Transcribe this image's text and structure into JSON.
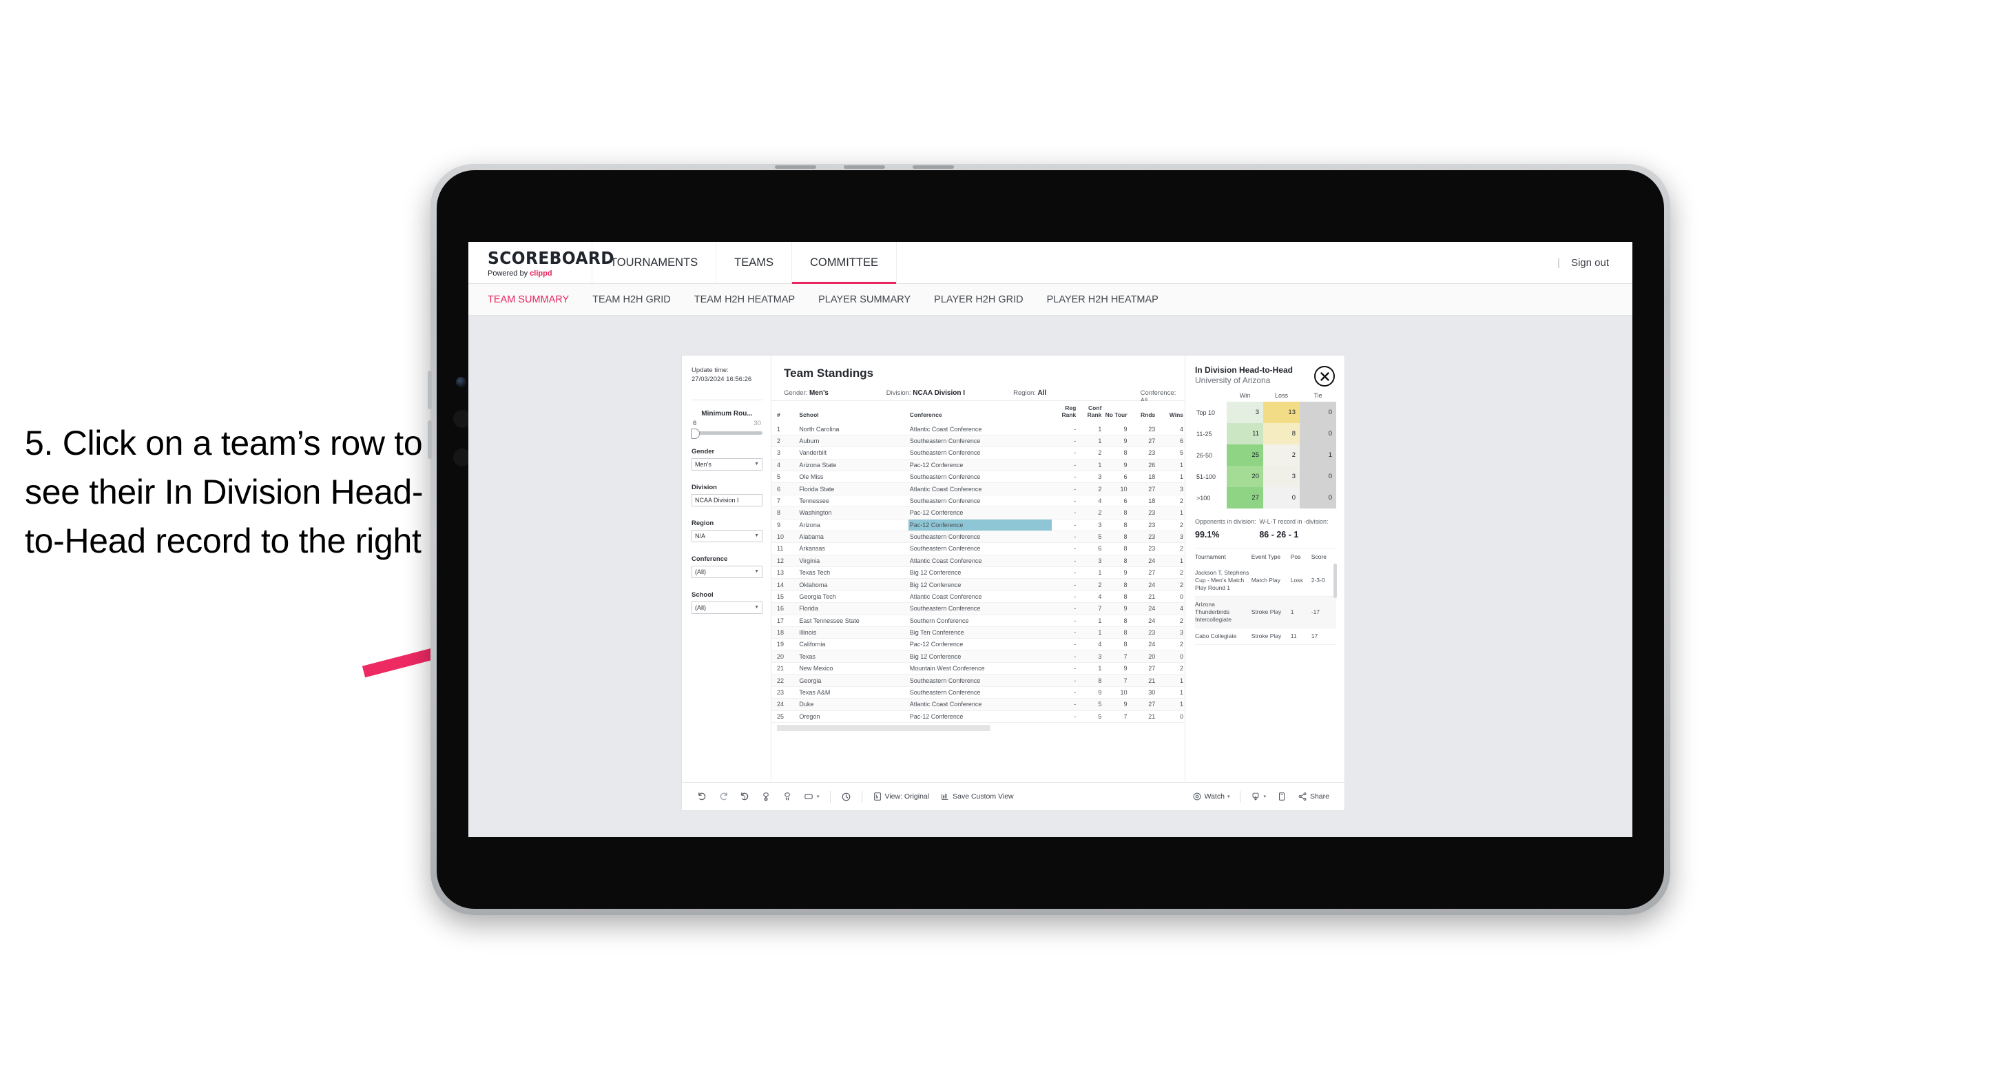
{
  "annotation": {
    "text": "5. Click on a team’s row to see their In Division Head-to-Head record to the right",
    "arrow_color": "#ee2a63"
  },
  "appbar": {
    "logo": "SCOREBOARD",
    "powered_prefix": "Powered by ",
    "powered_brand": "clippd",
    "nav": [
      {
        "label": "TOURNAMENTS",
        "active": false
      },
      {
        "label": "TEAMS",
        "active": false
      },
      {
        "label": "COMMITTEE",
        "active": true
      }
    ],
    "divider": "|",
    "sign_out": "Sign out"
  },
  "subnav": [
    {
      "label": "TEAM SUMMARY",
      "active": true
    },
    {
      "label": "TEAM H2H GRID",
      "active": false
    },
    {
      "label": "TEAM H2H HEATMAP",
      "active": false
    },
    {
      "label": "PLAYER SUMMARY",
      "active": false
    },
    {
      "label": "PLAYER H2H GRID",
      "active": false
    },
    {
      "label": "PLAYER H2H HEATMAP",
      "active": false
    }
  ],
  "filters": {
    "update_time_label": "Update time:",
    "update_time_value": "27/03/2024 16:56:26",
    "slider": {
      "title": "Minimum Rou...",
      "min": "6",
      "max": "30"
    },
    "groups": [
      {
        "label": "Gender",
        "value": "Men’s"
      },
      {
        "label": "Division",
        "value": "NCAA Division I"
      },
      {
        "label": "Region",
        "value": "N/A"
      },
      {
        "label": "Conference",
        "value": "(All)"
      },
      {
        "label": "School",
        "value": "(All)"
      }
    ]
  },
  "standings": {
    "title": "Team Standings",
    "meta": [
      {
        "key": "Gender:",
        "value": "Men’s"
      },
      {
        "key": "Division:",
        "value": "NCAA Division I"
      },
      {
        "key": "Region:",
        "value": "All"
      },
      {
        "key": "Conference:",
        "value": "All"
      }
    ],
    "columns": [
      "#",
      "School",
      "Conference",
      "Reg Rank",
      "Conf Rank",
      "No Tour",
      "Rnds",
      "Wins"
    ],
    "highlight_row_index": 8,
    "rows": [
      [
        "1",
        "North Carolina",
        "Atlantic Coast Conference",
        "-",
        "1",
        "9",
        "23",
        "4"
      ],
      [
        "2",
        "Auburn",
        "Southeastern Conference",
        "-",
        "1",
        "9",
        "27",
        "6"
      ],
      [
        "3",
        "Vanderbilt",
        "Southeastern Conference",
        "-",
        "2",
        "8",
        "23",
        "5"
      ],
      [
        "4",
        "Arizona State",
        "Pac-12 Conference",
        "-",
        "1",
        "9",
        "26",
        "1"
      ],
      [
        "5",
        "Ole Miss",
        "Southeastern Conference",
        "-",
        "3",
        "6",
        "18",
        "1"
      ],
      [
        "6",
        "Florida State",
        "Atlantic Coast Conference",
        "-",
        "2",
        "10",
        "27",
        "3"
      ],
      [
        "7",
        "Tennessee",
        "Southeastern Conference",
        "-",
        "4",
        "6",
        "18",
        "2"
      ],
      [
        "8",
        "Washington",
        "Pac-12 Conference",
        "-",
        "2",
        "8",
        "23",
        "1"
      ],
      [
        "9",
        "Arizona",
        "Pac-12 Conference",
        "-",
        "3",
        "8",
        "23",
        "2"
      ],
      [
        "10",
        "Alabama",
        "Southeastern Conference",
        "-",
        "5",
        "8",
        "23",
        "3"
      ],
      [
        "11",
        "Arkansas",
        "Southeastern Conference",
        "-",
        "6",
        "8",
        "23",
        "2"
      ],
      [
        "12",
        "Virginia",
        "Atlantic Coast Conference",
        "-",
        "3",
        "8",
        "24",
        "1"
      ],
      [
        "13",
        "Texas Tech",
        "Big 12 Conference",
        "-",
        "1",
        "9",
        "27",
        "2"
      ],
      [
        "14",
        "Oklahoma",
        "Big 12 Conference",
        "-",
        "2",
        "8",
        "24",
        "2"
      ],
      [
        "15",
        "Georgia Tech",
        "Atlantic Coast Conference",
        "-",
        "4",
        "8",
        "21",
        "0"
      ],
      [
        "16",
        "Florida",
        "Southeastern Conference",
        "-",
        "7",
        "9",
        "24",
        "4"
      ],
      [
        "17",
        "East Tennessee State",
        "Southern Conference",
        "-",
        "1",
        "8",
        "24",
        "2"
      ],
      [
        "18",
        "Illinois",
        "Big Ten Conference",
        "-",
        "1",
        "8",
        "23",
        "3"
      ],
      [
        "19",
        "California",
        "Pac-12 Conference",
        "-",
        "4",
        "8",
        "24",
        "2"
      ],
      [
        "20",
        "Texas",
        "Big 12 Conference",
        "-",
        "3",
        "7",
        "20",
        "0"
      ],
      [
        "21",
        "New Mexico",
        "Mountain West Conference",
        "-",
        "1",
        "9",
        "27",
        "2"
      ],
      [
        "22",
        "Georgia",
        "Southeastern Conference",
        "-",
        "8",
        "7",
        "21",
        "1"
      ],
      [
        "23",
        "Texas A&M",
        "Southeastern Conference",
        "-",
        "9",
        "10",
        "30",
        "1"
      ],
      [
        "24",
        "Duke",
        "Atlantic Coast Conference",
        "-",
        "5",
        "9",
        "27",
        "1"
      ],
      [
        "25",
        "Oregon",
        "Pac-12 Conference",
        "-",
        "5",
        "7",
        "21",
        "0"
      ]
    ]
  },
  "h2h": {
    "title": "In Division Head-to-Head",
    "subtitle": "University of Arizona",
    "close_icon": "close-x-icon",
    "chart_data": {
      "type": "heatmap",
      "title": "In Division Head-to-Head",
      "categories": [
        "Top 10",
        "11-25",
        "26-50",
        "51-100",
        ">100"
      ],
      "columns": [
        "Win",
        "Loss",
        "Tie"
      ],
      "values": [
        [
          3,
          13,
          0
        ],
        [
          11,
          8,
          0
        ],
        [
          25,
          2,
          1
        ],
        [
          20,
          3,
          0
        ],
        [
          27,
          0,
          0
        ]
      ],
      "cell_colors": [
        [
          "#e4efe2",
          "#f2dd86",
          "#d2d2d2"
        ],
        [
          "#cbe6c2",
          "#f6ecc2",
          "#d2d2d2"
        ],
        [
          "#8ed484",
          "#f2f1ea",
          "#d2d2d2"
        ],
        [
          "#a5dc95",
          "#f0efe8",
          "#d2d2d2"
        ],
        [
          "#8ed484",
          "#f1f1f1",
          "#d2d2d2"
        ]
      ]
    },
    "stats": [
      {
        "key": "Opponents in division:",
        "value": "99.1%"
      },
      {
        "key": "W-L-T record in -division:",
        "value": "86 - 26 - 1"
      }
    ],
    "tournaments": {
      "columns": [
        "Tournament",
        "Event Type",
        "Pos",
        "Score"
      ],
      "rows": [
        [
          "Jackson T. Stephens Cup - Men’s Match Play Round 1",
          "Match Play",
          "Loss",
          "2-3-0"
        ],
        [
          "Arizona Thunderbirds Intercollegiate",
          "Stroke Play",
          "1",
          "-17"
        ],
        [
          "Cabo Collegiate",
          "Stroke Play",
          "11",
          "17"
        ]
      ]
    }
  },
  "toolbar": {
    "undo": "undo-icon",
    "redo": "redo-icon",
    "revert": "revert-icon",
    "refresh": "refresh-data-icon",
    "pause": "pause-auto-update-icon",
    "device": "device-layout-icon",
    "device_caret": "▾",
    "history": "history-icon",
    "view_label": "View: Original",
    "save_label": "Save Custom View",
    "watch_label": "Watch",
    "watch_caret": "▾",
    "download_caret": "▾",
    "share_label": "Share"
  }
}
